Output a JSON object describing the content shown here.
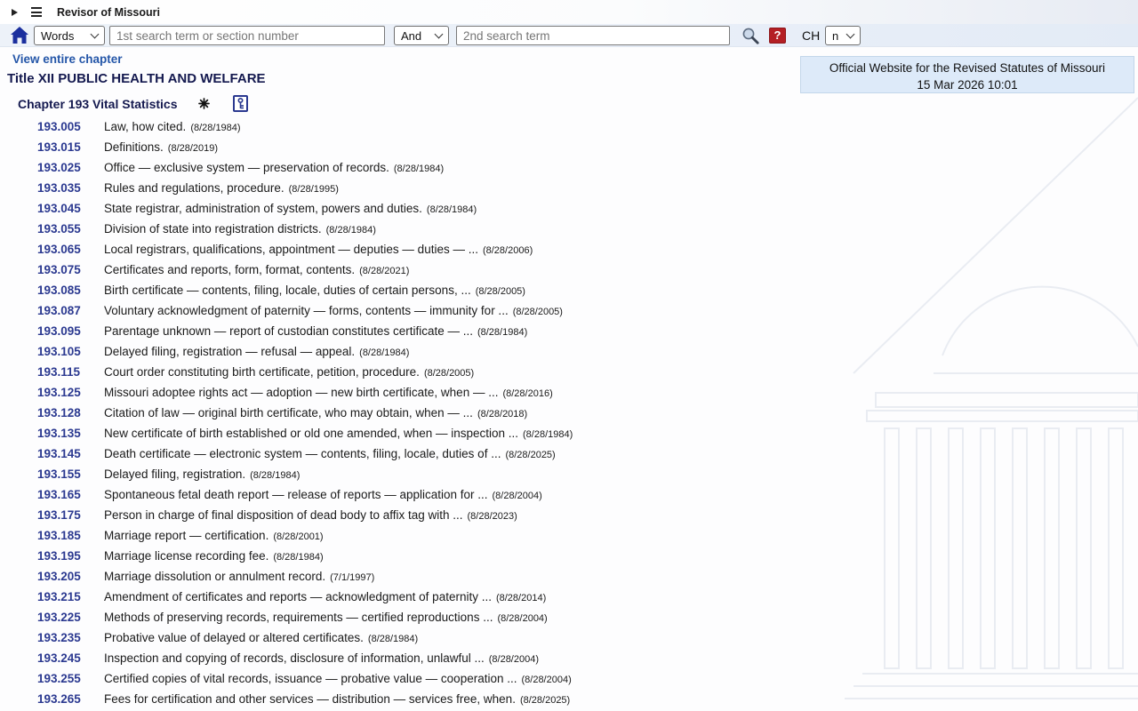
{
  "topbar": {
    "title": "Revisor of Missouri"
  },
  "search": {
    "field_select_value": "Words",
    "input1_placeholder": "1st search term or section number",
    "operator_select_value": "And",
    "input2_placeholder": "2nd search term",
    "help_label": "?",
    "ch_label": "CH",
    "chapter_select_value": "n"
  },
  "header": {
    "view_link": "View entire chapter",
    "title": "Title XII PUBLIC HEALTH AND WELFARE",
    "chapter": "Chapter 193 Vital Statistics"
  },
  "infobox": {
    "line1": "Official Website for the Revised Statutes of Missouri",
    "line2": "15 Mar 2026 10:01"
  },
  "colors": {
    "accent_navy": "#2b3990",
    "link_blue": "#2456a8",
    "help_red": "#b41f24",
    "infobox_bg": "#ddeaf9",
    "searchrow_bg": "#e9eff8"
  },
  "sections": [
    {
      "num": "193.005",
      "title": "Law, how cited.",
      "date": "(8/28/1984)"
    },
    {
      "num": "193.015",
      "title": "Definitions.",
      "date": "(8/28/2019)"
    },
    {
      "num": "193.025",
      "title": "Office — exclusive system — preservation of records.",
      "date": "(8/28/1984)"
    },
    {
      "num": "193.035",
      "title": "Rules and regulations, procedure.",
      "date": "(8/28/1995)"
    },
    {
      "num": "193.045",
      "title": "State registrar, administration of system, powers and duties.",
      "date": "(8/28/1984)"
    },
    {
      "num": "193.055",
      "title": "Division of state into registration districts.",
      "date": "(8/28/1984)"
    },
    {
      "num": "193.065",
      "title": "Local registrars, qualifications, appointment — deputies — duties — ...",
      "date": "(8/28/2006)"
    },
    {
      "num": "193.075",
      "title": "Certificates and reports, form, format, contents.",
      "date": "(8/28/2021)"
    },
    {
      "num": "193.085",
      "title": "Birth certificate — contents, filing, locale, duties of certain persons, ...",
      "date": "(8/28/2005)"
    },
    {
      "num": "193.087",
      "title": "Voluntary acknowledgment of paternity — forms, contents — immunity for ...",
      "date": "(8/28/2005)"
    },
    {
      "num": "193.095",
      "title": "Parentage unknown — report of custodian constitutes certificate — ...",
      "date": "(8/28/1984)"
    },
    {
      "num": "193.105",
      "title": "Delayed filing, registration — refusal — appeal.",
      "date": "(8/28/1984)"
    },
    {
      "num": "193.115",
      "title": "Court order constituting birth certificate, petition, procedure.",
      "date": "(8/28/2005)"
    },
    {
      "num": "193.125",
      "title": "Missouri adoptee rights act — adoption — new birth certificate, when — ...",
      "date": "(8/28/2016)"
    },
    {
      "num": "193.128",
      "title": "Citation of law — original birth certificate, who may obtain, when — ...",
      "date": "(8/28/2018)"
    },
    {
      "num": "193.135",
      "title": "New certificate of birth established or old one amended, when — inspection ...",
      "date": "(8/28/1984)"
    },
    {
      "num": "193.145",
      "title": "Death certificate — electronic system — contents, filing, locale, duties of ...",
      "date": "(8/28/2025)"
    },
    {
      "num": "193.155",
      "title": "Delayed filing, registration.",
      "date": "(8/28/1984)"
    },
    {
      "num": "193.165",
      "title": "Spontaneous fetal death report — release of reports — application for ...",
      "date": "(8/28/2004)"
    },
    {
      "num": "193.175",
      "title": "Person in charge of final disposition of dead body to affix tag with ...",
      "date": "(8/28/2023)"
    },
    {
      "num": "193.185",
      "title": "Marriage report — certification.",
      "date": "(8/28/2001)"
    },
    {
      "num": "193.195",
      "title": "Marriage license recording fee.",
      "date": "(8/28/1984)"
    },
    {
      "num": "193.205",
      "title": "Marriage dissolution or annulment record.",
      "date": "(7/1/1997)"
    },
    {
      "num": "193.215",
      "title": "Amendment of certificates and reports — acknowledgment of paternity ...",
      "date": "(8/28/2014)"
    },
    {
      "num": "193.225",
      "title": "Methods of preserving records, requirements — certified reproductions ...",
      "date": "(8/28/2004)"
    },
    {
      "num": "193.235",
      "title": "Probative value of delayed or altered certificates.",
      "date": "(8/28/1984)"
    },
    {
      "num": "193.245",
      "title": "Inspection and copying of records, disclosure of information, unlawful ...",
      "date": "(8/28/2004)"
    },
    {
      "num": "193.255",
      "title": "Certified copies of vital records, issuance — probative value — cooperation ...",
      "date": "(8/28/2004)"
    },
    {
      "num": "193.265",
      "title": "Fees for certification and other services — distribution — services free, when.",
      "date": "(8/28/2025)"
    }
  ]
}
